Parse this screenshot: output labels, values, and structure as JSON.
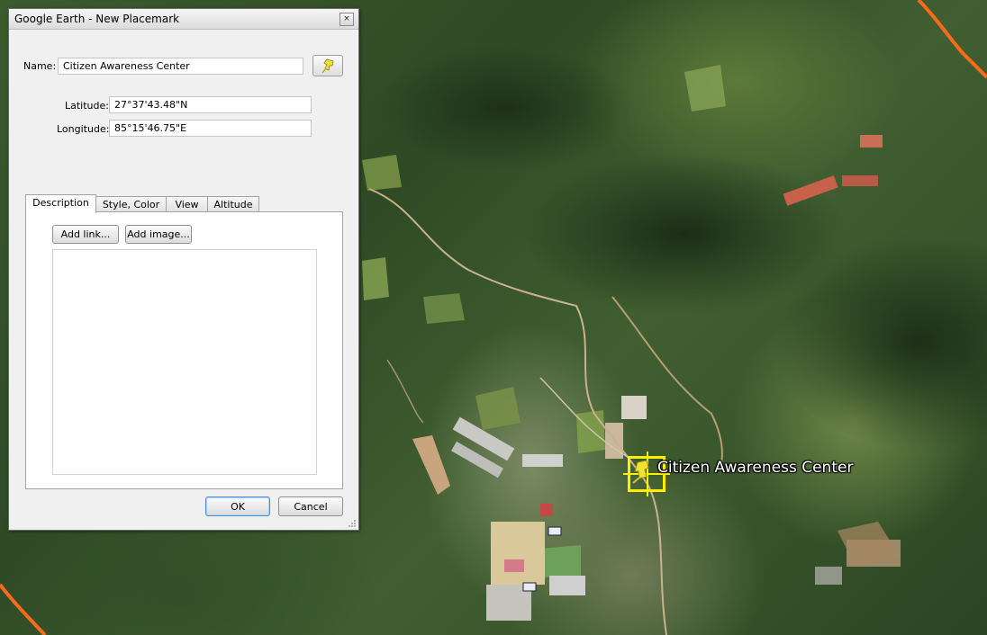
{
  "dialog": {
    "title": "Google Earth - New Placemark",
    "close_glyph": "×",
    "name_label": "Name:",
    "name_value": "Citizen Awareness Center",
    "latitude_label": "Latitude:",
    "latitude_value": "27°37'43.48\"N",
    "longitude_label": "Longitude:",
    "longitude_value": "85°15'46.75\"E",
    "pin_icon": "yellow-pushpin-icon",
    "tabs": [
      {
        "label": "Description",
        "active": true
      },
      {
        "label": "Style, Color",
        "active": false
      },
      {
        "label": "View",
        "active": false
      },
      {
        "label": "Altitude",
        "active": false
      }
    ],
    "add_link_label": "Add link...",
    "add_image_label": "Add image...",
    "description_value": "",
    "ok_label": "OK",
    "cancel_label": "Cancel"
  },
  "map": {
    "placemark_label": "Citizen Awareness Center",
    "placemark_icon": "yellow-pushpin-icon",
    "colors": {
      "boundary_line": "#ff6a1a",
      "placemark_highlight": "#ffee00"
    }
  }
}
